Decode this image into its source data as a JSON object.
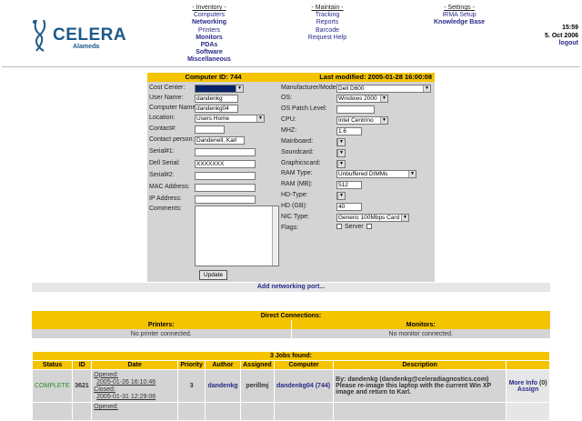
{
  "header": {
    "logo": "CELERA",
    "logo_sub": "Alameda",
    "inventory": {
      "title": "- Inventory -",
      "items": [
        "Computers",
        "Networking",
        "Printers",
        "Monitors",
        "PDAs",
        "Software",
        "Miscellaneous"
      ]
    },
    "maintain": {
      "title": "- Maintain -",
      "items": [
        "Tracking",
        "Reports",
        "Barcode",
        "Request Help"
      ]
    },
    "settings": {
      "title": "- Settings -",
      "items": [
        "IRMA Setup",
        "Knowledge Base"
      ]
    },
    "time": "15:59",
    "date": "5. Oct 2006",
    "logout": "logout"
  },
  "form": {
    "left_title": "Computer ID: 744",
    "right_title": "Last modified: 2005-01-28 16:00:08",
    "left": {
      "cost_center": "Cost Center:",
      "user_name": "User Name:",
      "user_name_val": "dandenkg",
      "computer_name": "Computer Name:",
      "computer_name_val": "dandenkg04",
      "location": "Location:",
      "location_val": "Users Home",
      "contact": "Contact#:",
      "contact_person": "Contact person:",
      "contact_person_val": "Dandenell, Karl",
      "serial1": "Serial#1:",
      "dell_serial": "Dell Serial:",
      "dell_serial_val": "XXXXXXX",
      "serial2": "Serial#2:",
      "mac": "MAC Address:",
      "ip": "IP Address:",
      "comments": "Comments:"
    },
    "right": {
      "model": "Manufacturer/Model:",
      "model_val": "Dell D600",
      "os": "OS:",
      "os_val": "Windows 2000",
      "patch": "OS Patch Level:",
      "cpu": "CPU:",
      "cpu_val": "Intel Centrino",
      "mhz": "MHZ:",
      "mhz_val": "1.6",
      "mainboard": "Mainboard:",
      "soundcard": "Soundcard:",
      "graphics": "Graphicscard:",
      "ram_type": "RAM Type:",
      "ram_type_val": "Unbuffered DIMMs",
      "ram": "RAM (MB):",
      "ram_val": "512",
      "hd_type": "HD-Type:",
      "hd": "HD (GB):",
      "hd_val": "40",
      "nic": "NIC Type:",
      "nic_val": "Generic 100Mbps Card",
      "flags": "Flags:",
      "server": "Server"
    },
    "update": "Update"
  },
  "add_port": "Add networking port...",
  "direct": {
    "title": "Direct Connections:",
    "printers": "Printers:",
    "monitors": "Monitors:",
    "no_printer": "No printer connected.",
    "no_monitor": "No monitor connected."
  },
  "jobs": {
    "title": "3 Jobs found:",
    "headers": [
      "Status",
      "ID",
      "Date",
      "Priority",
      "Author",
      "Assigned",
      "Computer",
      "Description"
    ],
    "rows": [
      {
        "status": "COMPLETE",
        "id": "3621",
        "opened": "Opened:",
        "opened_date": "2005-01-26 16:10:46",
        "closed": "Closed:",
        "closed_date": "2005-01-31 12:29:06",
        "priority": "3",
        "author": "dandenkg",
        "assigned": "perillmj",
        "computer": "dandenkg04 (744)",
        "desc1": "By: dandenkg (dandenkg@celeradiagnostics.com)",
        "desc2": "Please re-image this laptop with the current Win XP image and return to Karl.",
        "more": "More Info",
        "count": "(0)",
        "assign": "Assign"
      },
      {
        "opened": "Opened:"
      }
    ]
  }
}
